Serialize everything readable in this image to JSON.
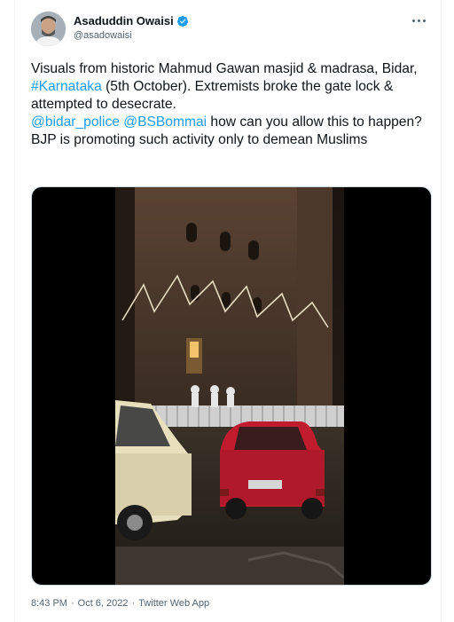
{
  "author": {
    "name": "Asaduddin Owaisi",
    "handle": "@asadowaisi",
    "verified_icon": "verified-badge-icon"
  },
  "tweet": {
    "text_part1": "Visuals from historic Mahmud Gawan masjid & madrasa, Bidar, ",
    "hashtag": "#Karnataka",
    "text_part2": " (5th October). Extremists broke the gate lock & attempted to desecrate.",
    "mention1": "@bidar_police",
    "space": " ",
    "mention2": "@BSBommai",
    "text_part3": " how can you allow this to happen? BJP is promoting such activity only to demean Muslims"
  },
  "meta": {
    "time": "8:43 PM",
    "separator1": "·",
    "date": "Oct 6, 2022",
    "separator2": "·",
    "app": "Twitter Web App"
  },
  "colors": {
    "link": "#1d9bf0",
    "text": "#0f1419",
    "secondary": "#536471"
  }
}
